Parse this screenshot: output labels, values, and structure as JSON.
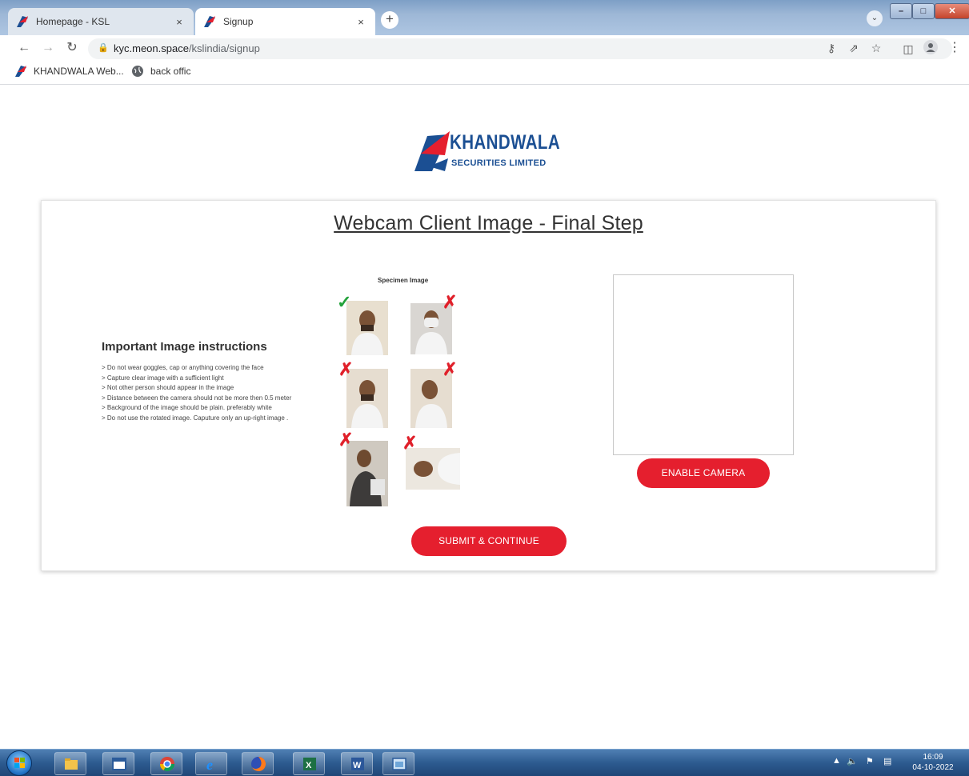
{
  "browser": {
    "tabs": [
      {
        "title": "Homepage - KSL",
        "close": "×"
      },
      {
        "title": "Signup",
        "close": "×"
      }
    ],
    "new_tab": "+",
    "url_host": "kyc.meon.space",
    "url_path": "/kslindia/signup",
    "bookmarks": [
      {
        "label": "KHANDWALA Web...",
        "icon": "ksl-favicon-icon"
      },
      {
        "label": "back offic",
        "icon": "globe-icon"
      }
    ]
  },
  "logo": {
    "name": "KHANDWALA",
    "subtitle": "SECURITIES LIMITED"
  },
  "page": {
    "heading": "Webcam Client Image - Final Step",
    "instructions_title": "Important Image instructions",
    "instructions": [
      "> Do not wear goggles, cap or anything covering the face",
      "> Capture clear image with a sufficient light",
      ">  Not other person  should appear in the image",
      "> Distance between the camera should not be more then  0.5 meter",
      "> Background of the image should be plain. preferably white",
      "> Do not use the rotated image. Caputure only an up-right image ."
    ],
    "specimen_label": "Specimen Image",
    "enable_camera": "ENABLE CAMERA",
    "submit": "SUBMIT & CONTINUE"
  },
  "taskbar": {
    "time": "16:09",
    "date": "04-10-2022",
    "apps": [
      "file-explorer-icon",
      "desktop-window-icon",
      "chrome-icon",
      "internet-explorer-icon",
      "firefox-icon",
      "excel-icon",
      "word-icon",
      "screenshot-tool-icon"
    ]
  },
  "colors": {
    "accent": "#e51f2e",
    "brand_blue": "#1b4f93"
  }
}
